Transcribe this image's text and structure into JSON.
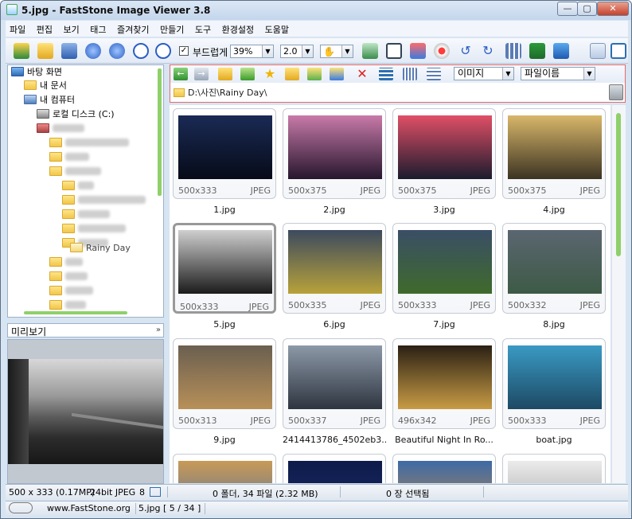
{
  "window": {
    "title": "5.jpg  -  FastStone Image Viewer 3.8",
    "min": "—",
    "max": "▢",
    "close": "✕"
  },
  "menu": [
    "파일",
    "편집",
    "보기",
    "태그",
    "즐겨찾기",
    "만들기",
    "도구",
    "환경설정",
    "도움말"
  ],
  "toolbar": {
    "smooth_label": "부드럽게",
    "smooth_checked": true,
    "zoom_value": "39%",
    "zoom_step_value": "2.0",
    "icons": [
      "import-icon",
      "open-folder-icon",
      "save-icon",
      "prev-icon",
      "next-icon",
      "zoom-in-icon",
      "zoom-out-icon",
      "hand-tool-icon",
      "resize-icon",
      "crop-icon",
      "color-icon",
      "red-eye-icon",
      "rotate-left-icon",
      "rotate-right-icon",
      "grid-icon",
      "slideshow-icon",
      "monitor-icon",
      "layout-icon",
      "fullscreen-icon"
    ]
  },
  "tree": {
    "items": [
      {
        "label": "바탕 화면"
      },
      {
        "label": "내 문서"
      },
      {
        "label": "내 컴퓨터"
      },
      {
        "label": "로컬 디스크 (C:)"
      },
      {
        "label": "Rainy Day"
      }
    ]
  },
  "preview": {
    "label": "미리보기",
    "dropdown": "»"
  },
  "nav": {
    "view_select": "이미지",
    "sort_select": "파일이름",
    "path": "D:\\사진\\Rainy Day\\"
  },
  "thumbs": [
    {
      "name": "1.jpg",
      "dim": "500x333",
      "type": "JPEG",
      "colors": [
        "#1a2a55",
        "#070b18"
      ],
      "selected": false
    },
    {
      "name": "2.jpg",
      "dim": "500x375",
      "type": "JPEG",
      "colors": [
        "#c87aa8",
        "#26162e"
      ],
      "selected": false
    },
    {
      "name": "3.jpg",
      "dim": "500x375",
      "type": "JPEG",
      "colors": [
        "#e04f66",
        "#1b1b2e"
      ],
      "selected": false
    },
    {
      "name": "4.jpg",
      "dim": "500x375",
      "type": "JPEG",
      "colors": [
        "#d9b76a",
        "#3b3322"
      ],
      "selected": false
    },
    {
      "name": "5.jpg",
      "dim": "500x333",
      "type": "JPEG",
      "colors": [
        "#cfcfcf",
        "#1b1b1b"
      ],
      "selected": true
    },
    {
      "name": "6.jpg",
      "dim": "500x335",
      "type": "JPEG",
      "colors": [
        "#3c4a5e",
        "#b8a23a"
      ],
      "selected": false
    },
    {
      "name": "7.jpg",
      "dim": "500x333",
      "type": "JPEG",
      "colors": [
        "#3a4e66",
        "#3f6a2b"
      ],
      "selected": false
    },
    {
      "name": "8.jpg",
      "dim": "500x332",
      "type": "JPEG",
      "colors": [
        "#5b6670",
        "#3d5a46"
      ],
      "selected": false
    },
    {
      "name": "9.jpg",
      "dim": "500x313",
      "type": "JPEG",
      "colors": [
        "#6a5f50",
        "#b89058"
      ],
      "selected": false
    },
    {
      "name": "2414413786_4502eb3...",
      "dim": "500x337",
      "type": "JPEG",
      "colors": [
        "#8d99a8",
        "#2e3540"
      ],
      "selected": false
    },
    {
      "name": "Beautiful Night In Ro...",
      "dim": "496x342",
      "type": "JPEG",
      "colors": [
        "#2a2014",
        "#c99c45"
      ],
      "selected": false
    },
    {
      "name": "boat.jpg",
      "dim": "500x333",
      "type": "JPEG",
      "colors": [
        "#3a9ac4",
        "#1d4a64"
      ],
      "selected": false
    },
    {
      "name": "",
      "dim": "",
      "type": "",
      "colors": [
        "#c99a55",
        "#4b6ea6"
      ],
      "selected": false
    },
    {
      "name": "",
      "dim": "",
      "type": "",
      "colors": [
        "#0d1a4a",
        "#1d2f6a"
      ],
      "selected": false
    },
    {
      "name": "",
      "dim": "",
      "type": "",
      "colors": [
        "#3d6aa6",
        "#c48a45"
      ],
      "selected": false
    },
    {
      "name": "",
      "dim": "",
      "type": "",
      "colors": [
        "#ececec",
        "#9a9a9a"
      ],
      "selected": false
    }
  ],
  "status": {
    "dims": "500 x 333 (0.17MP)",
    "format": "24bit JPEG",
    "num": "8",
    "counts": "0 폴더, 34 파일 (2.32 MB)",
    "selected": "0 장 선택됨",
    "site": "www.FastStone.org",
    "file_pos": "5.jpg [ 5 / 34 ]"
  }
}
